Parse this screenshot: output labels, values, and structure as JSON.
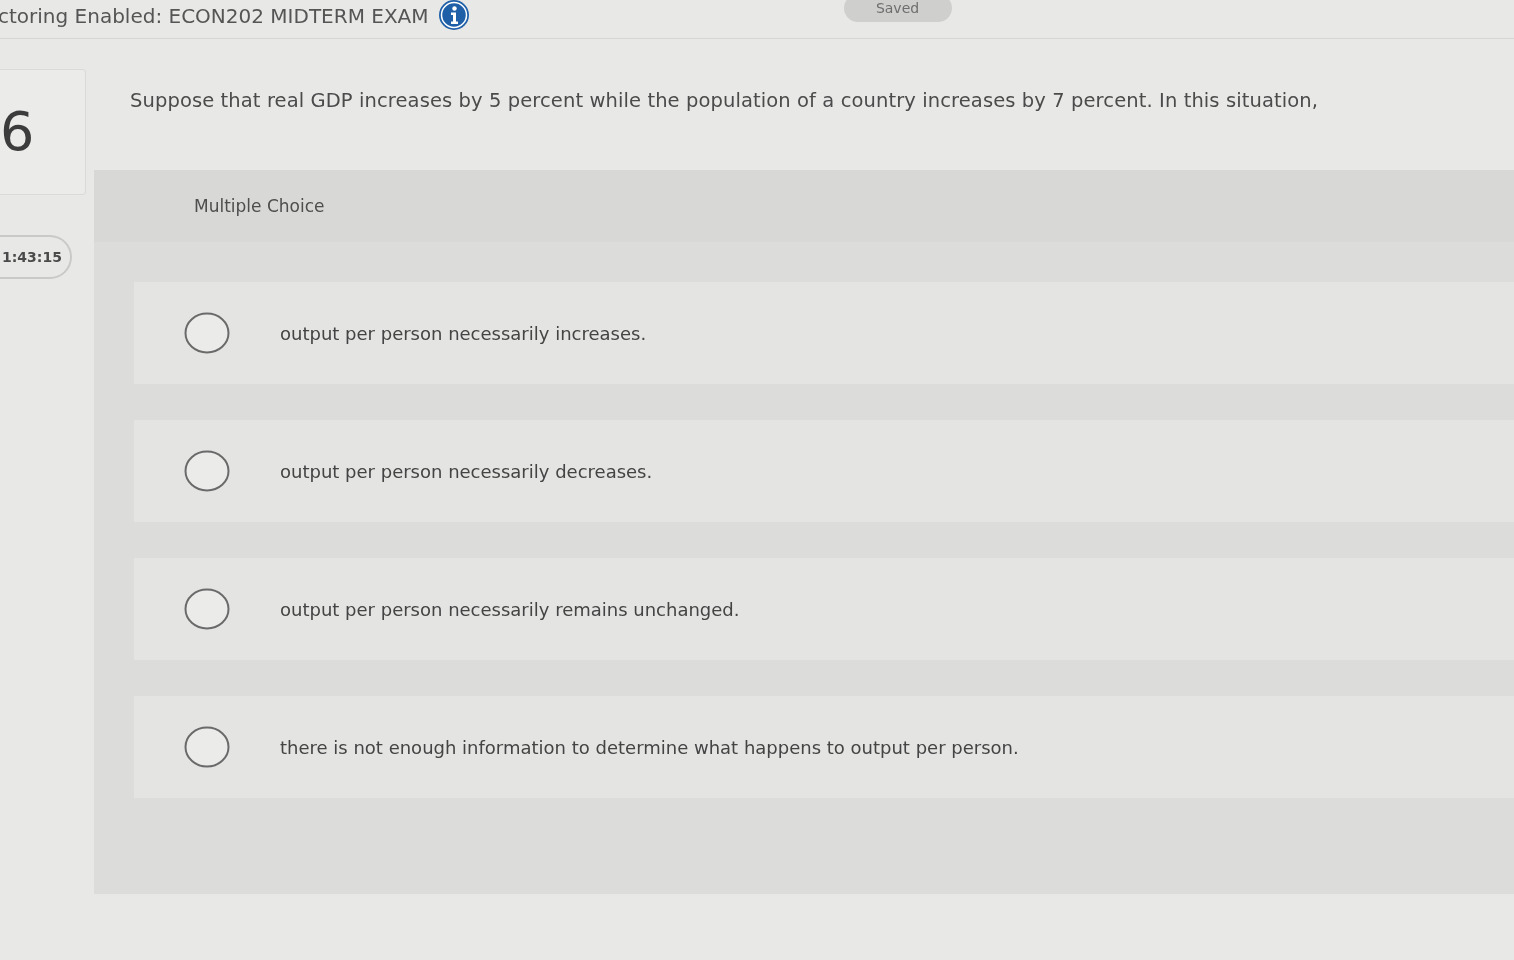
{
  "header": {
    "title": "ctoring Enabled: ECON202 MIDTERM EXAM",
    "save_status": "Saved"
  },
  "sidebar": {
    "question_number": "6",
    "timer": "1:43:15"
  },
  "question": {
    "prompt": "Suppose that real GDP increases by 5 percent while the population of a country increases by 7 percent. In this situation,",
    "type_label": "Multiple Choice",
    "options": [
      {
        "text": "output per person necessarily increases.",
        "selected": false
      },
      {
        "text": "output per person necessarily decreases.",
        "selected": false
      },
      {
        "text": "output per person necessarily remains unchanged.",
        "selected": false
      },
      {
        "text": "there is not enough information to determine what happens to output per person.",
        "selected": false
      }
    ]
  }
}
